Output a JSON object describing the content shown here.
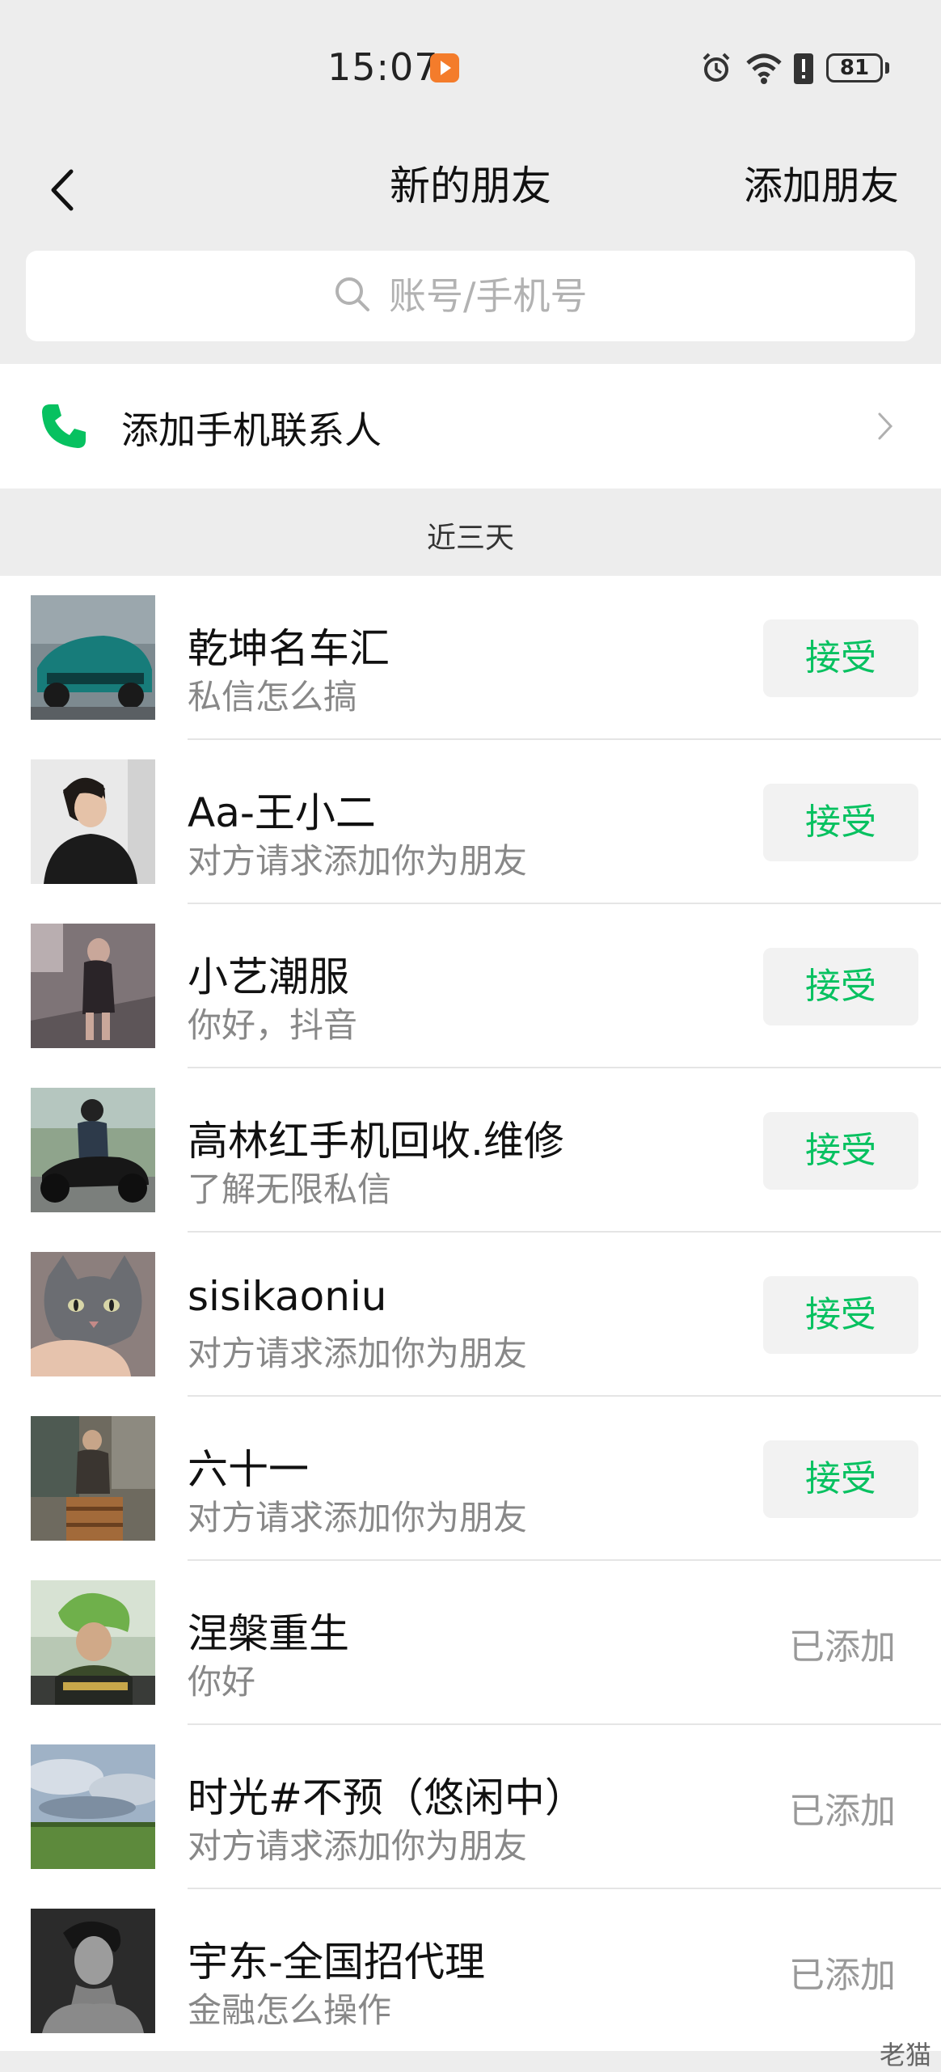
{
  "status_bar": {
    "time": "15:07",
    "battery": "81",
    "icons": [
      "app-notification-icon",
      "alarm-icon",
      "wifi-icon",
      "alert-icon",
      "battery-icon"
    ]
  },
  "nav": {
    "title": "新的朋友",
    "right_action": "添加朋友"
  },
  "search": {
    "placeholder": "账号/手机号"
  },
  "phone_contacts": {
    "label": "添加手机联系人",
    "icon_color": "#07c160"
  },
  "section": {
    "title": "近三天"
  },
  "requests": [
    {
      "name": "乾坤名车汇",
      "message": "私信怎么搞",
      "status": "接受"
    },
    {
      "name": "Aa-王小二",
      "message": "对方请求添加你为朋友",
      "status": "接受"
    },
    {
      "name": "小艺潮服",
      "message": "你好，抖音",
      "status": "接受"
    },
    {
      "name": "高林红手机回收.维修",
      "message": "了解无限私信",
      "status": "接受"
    },
    {
      "name": "sisikaoniu",
      "message": "对方请求添加你为朋友",
      "status": "接受"
    },
    {
      "name": "六十一",
      "message": "对方请求添加你为朋友",
      "status": "接受"
    },
    {
      "name": "涅槃重生",
      "message": "你好",
      "status": "已添加"
    },
    {
      "name": "时光#不预（悠闲中）",
      "message": "对方请求添加你为朋友",
      "status": "已添加"
    },
    {
      "name": "宇东-全国招代理",
      "message": "金融怎么操作",
      "status": "已添加"
    }
  ],
  "watermark": "老猫",
  "colors": {
    "accent_green": "#07c160",
    "background": "#ededed",
    "button_bg": "#f2f2f2",
    "secondary_text": "#888888"
  }
}
